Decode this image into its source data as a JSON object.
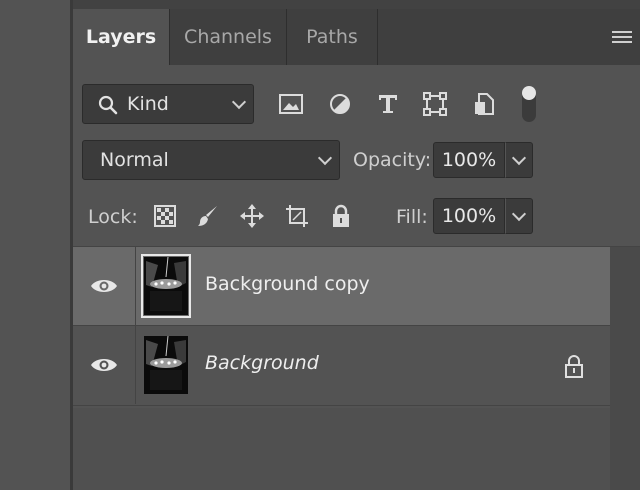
{
  "tabs": [
    {
      "label": "Layers",
      "active": true
    },
    {
      "label": "Channels",
      "active": false
    },
    {
      "label": "Paths",
      "active": false
    }
  ],
  "filter": {
    "kind_label": "Kind",
    "icons": [
      "image-filter-icon",
      "adjustment-filter-icon",
      "type-filter-icon",
      "shape-filter-icon",
      "smart-object-filter-icon",
      "filter-toggle-icon"
    ]
  },
  "blend": {
    "mode": "Normal",
    "opacity_label": "Opacity:",
    "opacity_value": "100%"
  },
  "lock": {
    "label": "Lock:",
    "fill_label": "Fill:",
    "fill_value": "100%"
  },
  "layers": [
    {
      "name": "Background copy",
      "selected": true,
      "visible": true,
      "locked": false
    },
    {
      "name": "Background",
      "selected": false,
      "visible": true,
      "locked": true
    }
  ],
  "colors": {
    "panel_bg": "#535353",
    "tabbar_bg": "#3f3f3f",
    "selected_row": "#6a6a6a",
    "field_bg": "#3b3b3b"
  }
}
